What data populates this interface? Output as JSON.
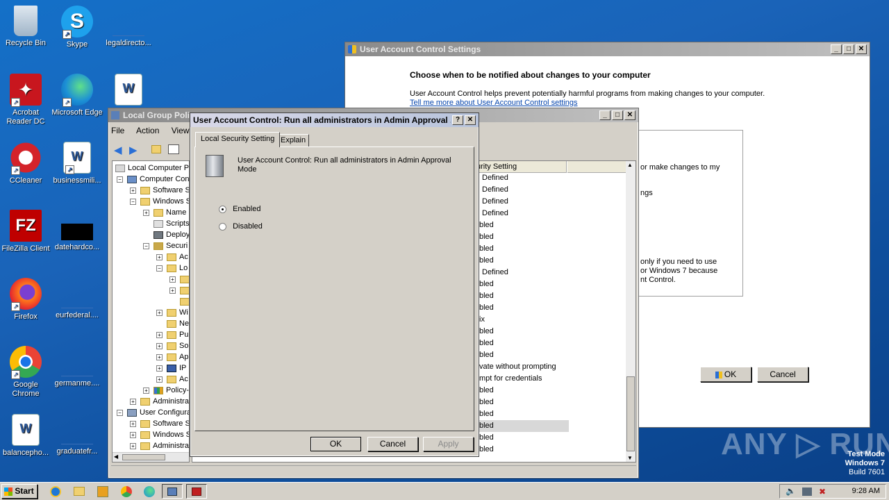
{
  "desktop": {
    "icons": [
      {
        "label": "Recycle Bin"
      },
      {
        "label": "Skype"
      },
      {
        "label": "legaldirecto..."
      },
      {
        "label": "Acrobat Reader DC"
      },
      {
        "label": "Microsoft Edge"
      },
      {
        "label": "CCleaner"
      },
      {
        "label": "businessmili..."
      },
      {
        "label": "FileZilla Client"
      },
      {
        "label": "datehardco..."
      },
      {
        "label": "Firefox"
      },
      {
        "label": "eurfederal...."
      },
      {
        "label": "Google Chrome"
      },
      {
        "label": "germanme...."
      },
      {
        "label": "balancepho..."
      },
      {
        "label": "graduatefr..."
      }
    ]
  },
  "uac_settings": {
    "title": "User Account Control Settings",
    "heading": "Choose when to be notified about changes to your computer",
    "description": "User Account Control helps prevent potentially harmful programs from making changes to your computer.",
    "link": "Tell me more about User Account Control settings",
    "frag1": "or make changes to my",
    "frag2": "ngs",
    "frag3": "only if you need to use",
    "frag4": "or Windows 7 because",
    "frag5": "nt Control.",
    "ok": "OK",
    "cancel": "Cancel"
  },
  "gpo": {
    "title": "Local Group Polic",
    "menu": {
      "file": "File",
      "action": "Action",
      "view": "View"
    },
    "tree": [
      "Local Computer Po",
      "Computer Con",
      "Software S",
      "Windows S",
      "Name",
      "Scripts",
      "Deploy",
      "Securi",
      "Ac",
      "Lo",
      "",
      "",
      "",
      "Wi",
      "Ne",
      "Pu",
      "So",
      "Ap",
      "IP",
      "Ac",
      "Policy-",
      "Administra",
      "User Configura",
      "Software S",
      "Windows S",
      "Administra"
    ],
    "column_header": "urity Setting",
    "list": [
      "Defined",
      "Defined",
      "Defined",
      "Defined",
      "bled",
      "bled",
      "bled",
      "bled",
      "Defined",
      "bled",
      "bled",
      "bled",
      "ix",
      "bled",
      "bled",
      "bled",
      "vate without prompting",
      "mpt for credentials",
      "bled",
      "bled",
      "bled",
      "bled",
      "bled",
      "bled"
    ]
  },
  "dialog": {
    "title": "User Account Control: Run all administrators in Admin Approval ...",
    "help": "?",
    "close": "✕",
    "tabs": {
      "setting": "Local Security Setting",
      "explain": "Explain"
    },
    "policy_name": "User Account Control: Run all administrators in Admin Approval Mode",
    "options": {
      "enabled": "Enabled",
      "disabled": "Disabled"
    },
    "selected": "Enabled",
    "buttons": {
      "ok": "OK",
      "cancel": "Cancel",
      "apply": "Apply"
    }
  },
  "watermark": {
    "brand": "ANY ▷ RUN",
    "line1": "Test Mode",
    "line2": "Windows 7",
    "line3": "Build 7601"
  },
  "taskbar": {
    "start": "Start",
    "time": "9:28 AM"
  }
}
